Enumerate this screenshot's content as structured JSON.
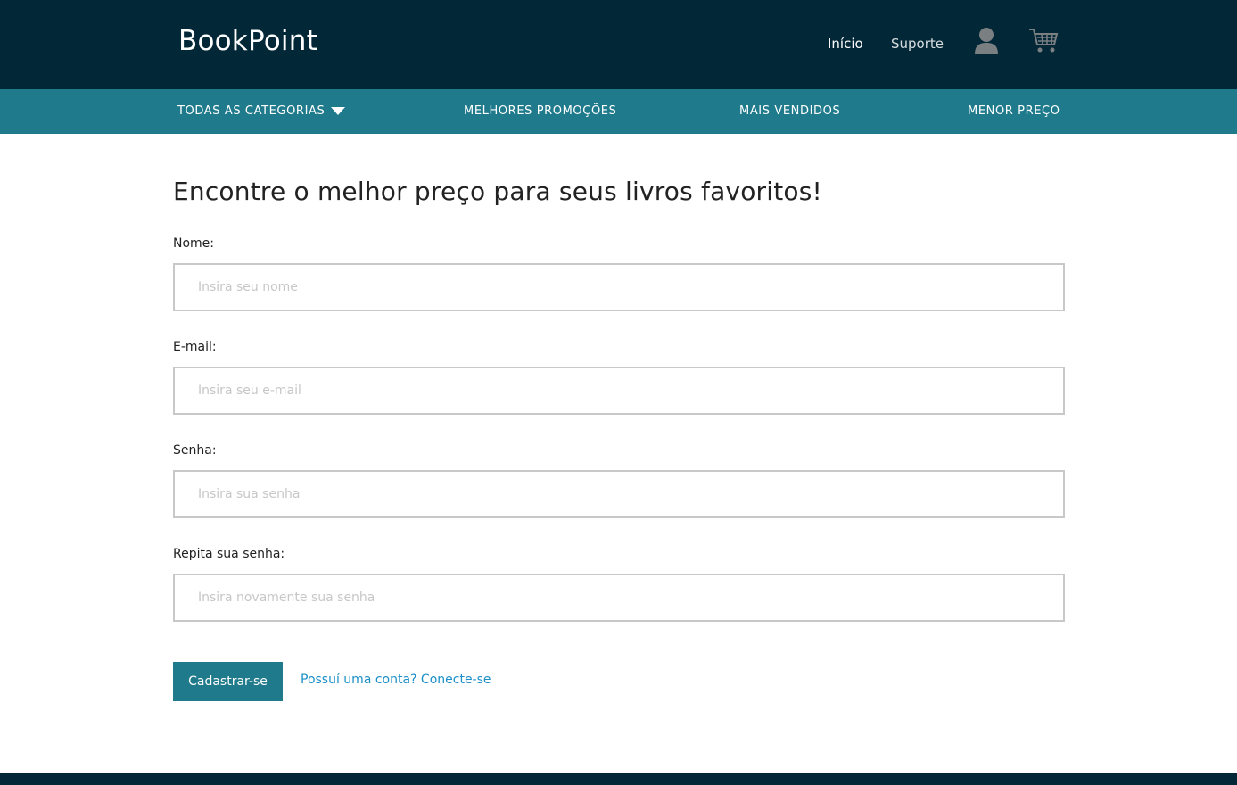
{
  "header": {
    "logo": "BookPoint",
    "links": [
      {
        "label": "Início"
      },
      {
        "label": "Suporte"
      }
    ],
    "icons": [
      "user-icon",
      "cart-icon"
    ]
  },
  "categories": {
    "items": [
      {
        "label": "TODAS AS CATEGORIAS"
      },
      {
        "label": "MELHORES PROMOÇÕES"
      },
      {
        "label": "MAIS VENDIDOS"
      },
      {
        "label": "MENOR PREÇO"
      }
    ]
  },
  "form": {
    "title": "Encontre o melhor preço para seus livros favoritos!",
    "fields": [
      {
        "label": "Nome:",
        "placeholder": "Insira seu nome",
        "value": ""
      },
      {
        "label": "E-mail:",
        "placeholder": "Insira seu e-mail",
        "value": ""
      },
      {
        "label": "Senha:",
        "placeholder": "Insira sua senha",
        "value": ""
      },
      {
        "label": "Repita sua senha:",
        "placeholder": "Insira novamente sua senha",
        "value": ""
      }
    ],
    "submit_label": "Cadastrar-se",
    "login_link": "Possuí uma conta? Conecte-se"
  },
  "colors": {
    "header_bg": "#022838",
    "category_bar_bg": "#1f7a8c",
    "button_bg": "#1f7a8c",
    "link": "#1b8fc8"
  }
}
